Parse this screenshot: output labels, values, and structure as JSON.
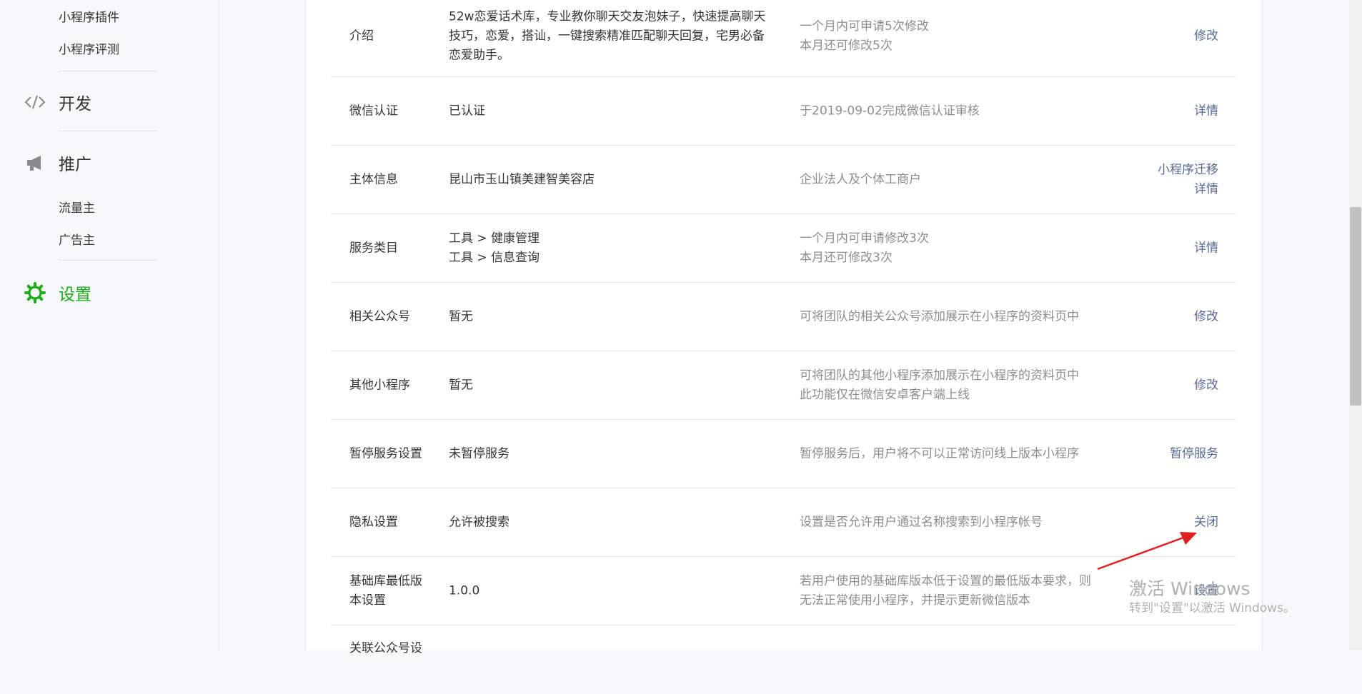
{
  "sidebar": {
    "sub_items_top": [
      "小程序插件",
      "小程序评测"
    ],
    "dev_label": "开发",
    "promo_label": "推广",
    "promo_items": [
      "流量主",
      "广告主"
    ],
    "settings_label": "设置"
  },
  "rows": [
    {
      "label": [
        "介绍"
      ],
      "value": [
        "52w恋爱话术库，专业教你聊天交友泡妹子，快速提高聊天",
        "技巧，恋爱，搭讪，一键搜索精准匹配聊天回复，宅男必备",
        "恋爱助手。"
      ],
      "desc": [
        "一个月内可申请5次修改",
        "本月还可修改5次"
      ],
      "actions": [
        "修改"
      ]
    },
    {
      "label": [
        "微信认证"
      ],
      "value": [
        "已认证"
      ],
      "desc": [
        "于2019-09-02完成微信认证审核"
      ],
      "actions": [
        "详情"
      ]
    },
    {
      "label": [
        "主体信息"
      ],
      "value": [
        "昆山市玉山镇美建智美容店"
      ],
      "desc": [
        "企业法人及个体工商户"
      ],
      "actions": [
        "小程序迁移",
        "详情"
      ]
    },
    {
      "label": [
        "服务类目"
      ],
      "value": [
        "工具 > 健康管理",
        "工具 > 信息查询"
      ],
      "desc": [
        "一个月内可申请修改3次",
        "本月还可修改3次"
      ],
      "actions": [
        "详情"
      ]
    },
    {
      "label": [
        "相关公众号"
      ],
      "value": [
        "暂无"
      ],
      "desc": [
        "可将团队的相关公众号添加展示在小程序的资料页中"
      ],
      "actions": [
        "修改"
      ]
    },
    {
      "label": [
        "其他小程序"
      ],
      "value": [
        "暂无"
      ],
      "desc": [
        "可将团队的其他小程序添加展示在小程序的资料页中",
        "此功能仅在微信安卓客户端上线"
      ],
      "actions": [
        "修改"
      ]
    },
    {
      "label": [
        "暂停服务设置"
      ],
      "value": [
        "未暂停服务"
      ],
      "desc": [
        "暂停服务后，用户将不可以正常访问线上版本小程序"
      ],
      "actions": [
        "暂停服务"
      ]
    },
    {
      "label": [
        "隐私设置"
      ],
      "value": [
        "允许被搜索"
      ],
      "desc": [
        "设置是否允许用户通过名称搜索到小程序帐号"
      ],
      "actions": [
        "关闭"
      ]
    },
    {
      "label": [
        "基础库最低版",
        "本设置"
      ],
      "value": [
        "1.0.0"
      ],
      "desc": [
        "若用户使用的基础库版本低于设置的最低版本要求，则",
        "无法正常使用小程序，并提示更新微信版本"
      ],
      "actions": [
        "设置"
      ]
    },
    {
      "label": [
        "关联公众号设"
      ],
      "value": [],
      "desc": [],
      "actions": []
    }
  ],
  "watermark": {
    "line1": "激活 Windows",
    "line2": "转到\"设置\"以激活 Windows。"
  },
  "colors": {
    "accent": "#1aad19",
    "link": "#576b95",
    "arrow": "#e02020"
  },
  "icons": {
    "dev": "code-icon",
    "promo": "megaphone-icon",
    "settings": "gear-icon"
  }
}
